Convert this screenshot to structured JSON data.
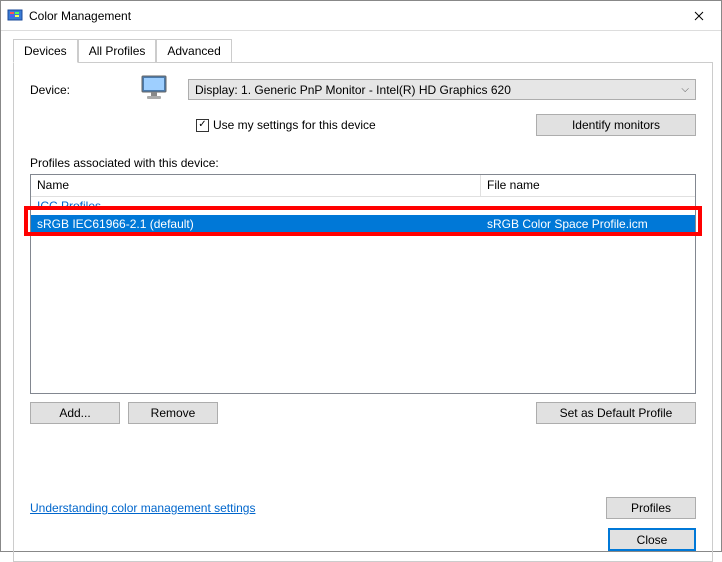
{
  "window": {
    "title": "Color Management"
  },
  "tabs": {
    "devices": "Devices",
    "all_profiles": "All Profiles",
    "advanced": "Advanced"
  },
  "device": {
    "label": "Device:",
    "selected": "Display: 1. Generic PnP Monitor - Intel(R) HD Graphics 620",
    "use_settings_label": "Use my settings for this device",
    "use_settings_checked": true,
    "identify_button": "Identify monitors"
  },
  "profiles": {
    "section_label": "Profiles associated with this device:",
    "columns": {
      "name": "Name",
      "filename": "File name"
    },
    "group": "ICC Profiles",
    "rows": [
      {
        "name": "sRGB IEC61966-2.1 (default)",
        "filename": "sRGB Color Space Profile.icm",
        "selected": true
      }
    ]
  },
  "buttons": {
    "add": "Add...",
    "remove": "Remove",
    "set_default": "Set as Default Profile",
    "profiles": "Profiles",
    "close": "Close"
  },
  "link": "Understanding color management settings"
}
